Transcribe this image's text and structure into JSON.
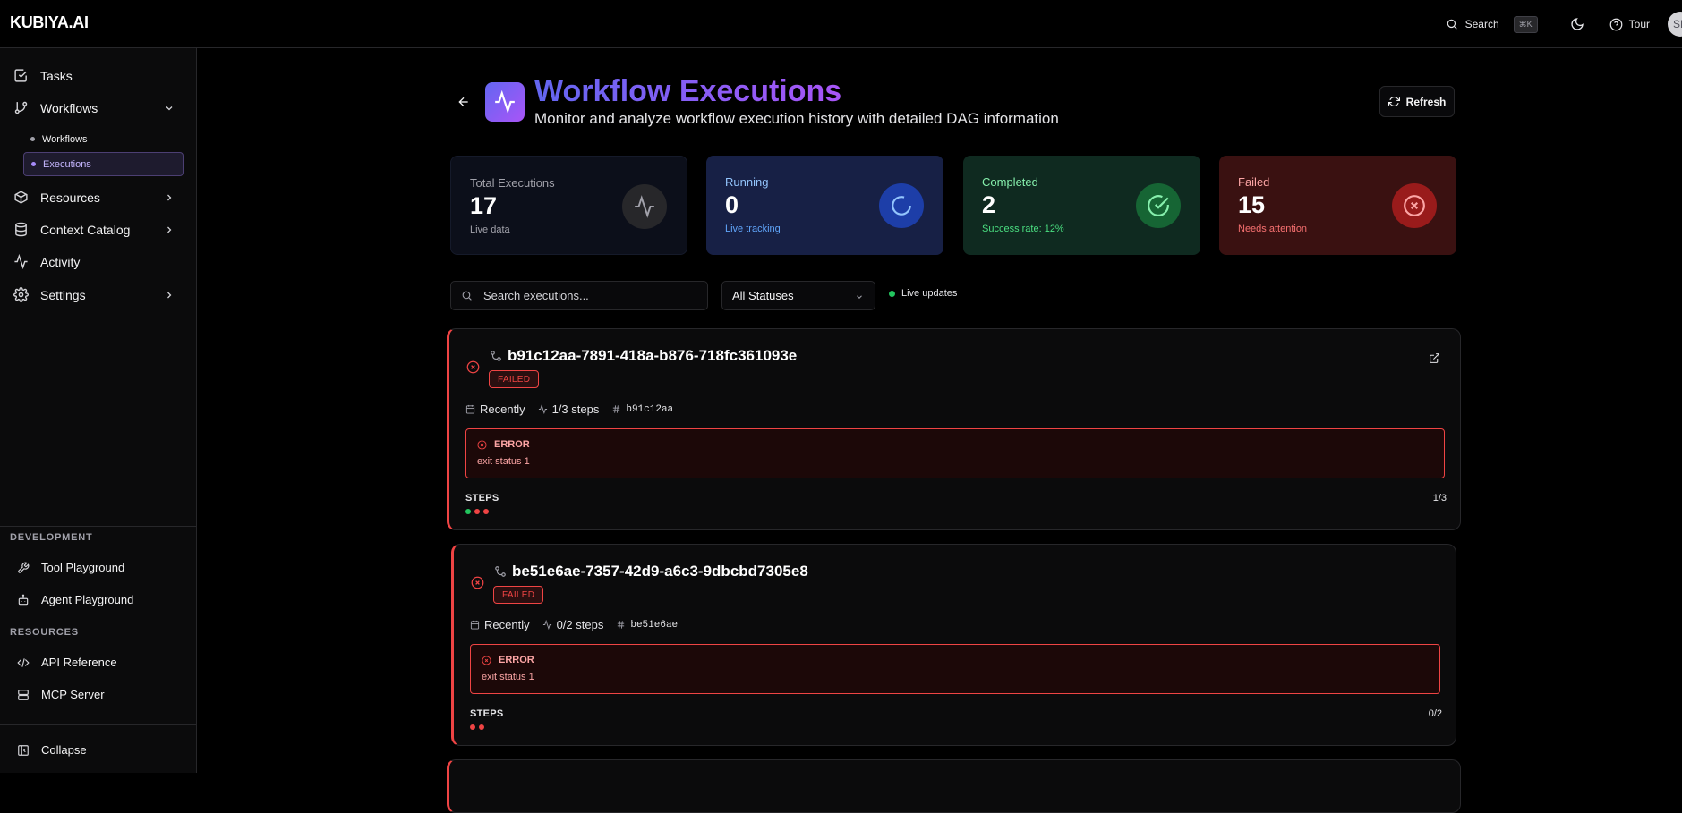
{
  "app": {
    "logo": "KUBIYA.AI"
  },
  "topbar": {
    "search_label": "Search",
    "search_shortcut": "⌘K",
    "tour_label": "Tour",
    "avatar_initials": "SH"
  },
  "sidebar": {
    "items": [
      {
        "label": "Tasks",
        "icon": "check-square-icon"
      },
      {
        "label": "Workflows",
        "icon": "git-branch-icon",
        "expanded": true
      },
      {
        "label": "Resources",
        "icon": "package-icon"
      },
      {
        "label": "Context Catalog",
        "icon": "database-icon"
      },
      {
        "label": "Activity",
        "icon": "activity-icon"
      },
      {
        "label": "Settings",
        "icon": "gear-icon"
      }
    ],
    "sub_items": [
      {
        "label": "Workflows"
      },
      {
        "label": "Executions",
        "active": true
      }
    ],
    "development_label": "DEVELOPMENT",
    "development_items": [
      {
        "label": "Tool Playground",
        "icon": "wrench-icon"
      },
      {
        "label": "Agent Playground",
        "icon": "bot-icon"
      }
    ],
    "resources_label": "RESOURCES",
    "resources_items": [
      {
        "label": "API Reference",
        "icon": "code-icon"
      },
      {
        "label": "MCP Server",
        "icon": "server-icon"
      }
    ],
    "collapse_label": "Collapse"
  },
  "header": {
    "title": "Workflow Executions",
    "subtitle": "Monitor and analyze workflow execution history with detailed DAG information",
    "refresh_label": "Refresh"
  },
  "stats": {
    "total": {
      "label": "Total Executions",
      "value": "17",
      "sub": "Live data"
    },
    "running": {
      "label": "Running",
      "value": "0",
      "sub": "Live tracking"
    },
    "completed": {
      "label": "Completed",
      "value": "2",
      "sub": "Success rate: 12%"
    },
    "failed": {
      "label": "Failed",
      "value": "15",
      "sub": "Needs attention"
    }
  },
  "filters": {
    "search_placeholder": "Search executions...",
    "status_value": "All Statuses",
    "live_label": "Live updates"
  },
  "executions": [
    {
      "id": "b91c12aa-7891-418a-b876-718fc361093e",
      "status": "FAILED",
      "time": "Recently",
      "steps_text": "1/3 steps",
      "short_hash": "b91c12aa",
      "error_title": "ERROR",
      "error_message": "exit status 1",
      "steps_label": "STEPS",
      "steps_count": "1/3",
      "step_states": [
        "success",
        "failed",
        "failed"
      ]
    },
    {
      "id": "be51e6ae-7357-42d9-a6c3-9dbcbd7305e8",
      "status": "FAILED",
      "time": "Recently",
      "steps_text": "0/2 steps",
      "short_hash": "be51e6ae",
      "error_title": "ERROR",
      "error_message": "exit status 1",
      "steps_label": "STEPS",
      "steps_count": "0/2",
      "step_states": [
        "failed",
        "failed"
      ]
    }
  ],
  "colors": {
    "accent_from": "#6366f1",
    "accent_to": "#a855f7",
    "failed": "#ef4444",
    "success": "#22c55e"
  }
}
